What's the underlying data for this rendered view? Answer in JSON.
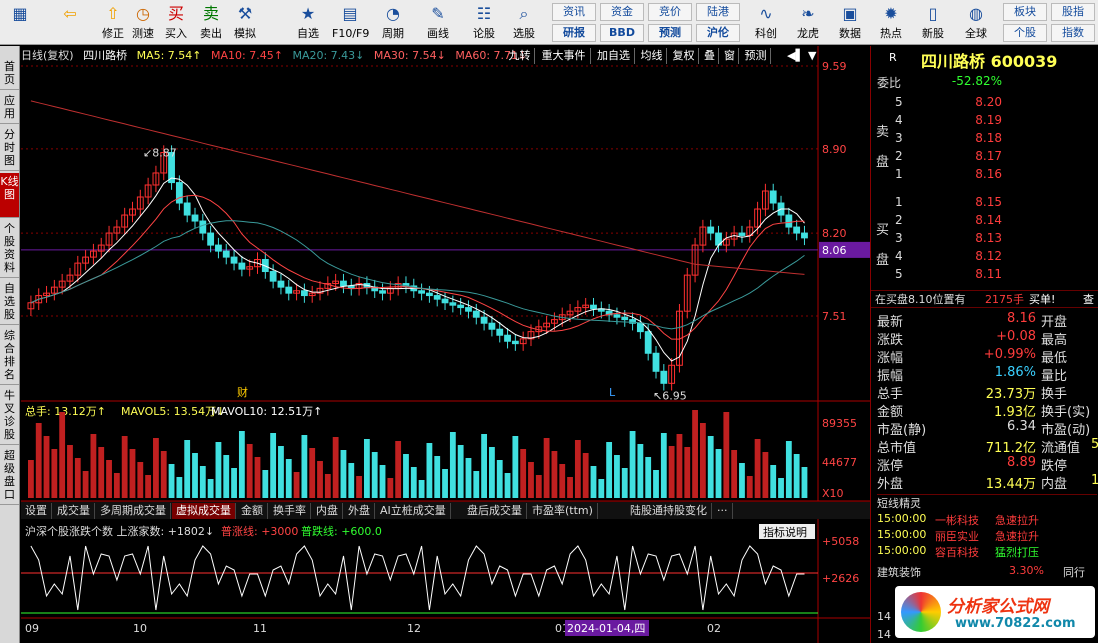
{
  "toolbar": {
    "big": [
      {
        "label": "",
        "icon": "windows-icon"
      },
      {
        "label": "",
        "icon": "back-arrow-icon"
      },
      {
        "label": "修正",
        "icon": "up-arrow-icon"
      },
      {
        "label": "测速",
        "icon": "clock-icon"
      },
      {
        "label": "买入",
        "icon": "buy-icon",
        "glyph": "买"
      },
      {
        "label": "卖出",
        "icon": "sell-icon",
        "glyph": "卖"
      },
      {
        "label": "模拟",
        "icon": "hammer-icon"
      },
      {
        "label": "自选",
        "icon": "star-icon"
      },
      {
        "label": "F10/F9",
        "icon": "f10-icon"
      },
      {
        "label": "周期",
        "icon": "cycle-icon"
      },
      {
        "label": "画线",
        "icon": "pen-icon"
      },
      {
        "label": "论股",
        "icon": "discuss-icon"
      },
      {
        "label": "选股",
        "icon": "search-icon"
      },
      {
        "label": "科创",
        "icon": "kechuang-icon"
      },
      {
        "label": "龙虎",
        "icon": "dragon-icon"
      },
      {
        "label": "数据",
        "icon": "pe-icon"
      },
      {
        "label": "热点",
        "icon": "hot-icon"
      },
      {
        "label": "新股",
        "icon": "ipo-icon"
      },
      {
        "label": "全球",
        "icon": "globe-icon"
      }
    ],
    "small": [
      [
        "资讯",
        "研报"
      ],
      [
        "资金",
        "BBD"
      ],
      [
        "竞价",
        "预测"
      ],
      [
        "陆港",
        "沪伦"
      ]
    ],
    "right": [
      [
        "板块",
        "个股"
      ],
      [
        "股指",
        "指数"
      ]
    ]
  },
  "sidebar": [
    "首页",
    "应用",
    "分时图",
    "K线图",
    "个股资料",
    "自选股",
    "综合排名",
    "牛叉诊股",
    "超级盘口"
  ],
  "header": {
    "period": "日线(复权)",
    "name": "四川路桥",
    "ma5": "MA5: 7.54↑",
    "ma10": "MA10: 7.45↑",
    "ma20": "MA20: 7.43↓",
    "ma30": "MA30: 7.54↓",
    "ma60": "MA60: 7.71↓",
    "buttons": [
      "九转",
      "重大事件",
      "加自选",
      "均线",
      "复权",
      "叠",
      "窗",
      "预测"
    ]
  },
  "price_axis": [
    "9.59",
    "8.90",
    "8.20",
    "8.06",
    "7.51"
  ],
  "annotations": {
    "high": "8.87",
    "low": "6.95",
    "fin": "财",
    "l": "L"
  },
  "volume": {
    "label": "总手: 13.12万↑",
    "mavol5": "MAVOL5: 13.54万↓",
    "mavol10": "MAVOL10: 12.51万↑",
    "axis": [
      "89355",
      "44677",
      "X10"
    ]
  },
  "tabs": [
    "设置",
    "成交量",
    "多周期成交量",
    "虚拟成交量",
    "金额",
    "换手率",
    "内盘",
    "外盘",
    "AI立桩成交量",
    "盘后成交量",
    "市盈率(ttm)",
    "陆股通持股变化",
    "···"
  ],
  "indicator": {
    "label": "沪深个股涨跌个数 上涨家数: +1802↓",
    "l2": "普涨线: +3000",
    "l3": "普跌线: +600.0",
    "help": "指标说明",
    "axis": [
      "+5058",
      "+2626"
    ]
  },
  "xaxis": [
    "09",
    "10",
    "11",
    "12",
    "01",
    "2024-01-04,四",
    "02"
  ],
  "right": {
    "title": "四川路桥 600039",
    "r": "R",
    "weibi_label": "委比",
    "weibi": "-52.82%",
    "sell_label": "卖盘",
    "sell": [
      [
        "5",
        "8.20"
      ],
      [
        "4",
        "8.19"
      ],
      [
        "3",
        "8.18"
      ],
      [
        "2",
        "8.17"
      ],
      [
        "1",
        "8.16"
      ]
    ],
    "buy_label": "买盘",
    "buy": [
      [
        "1",
        "8.15"
      ],
      [
        "2",
        "8.14"
      ],
      [
        "3",
        "8.13"
      ],
      [
        "4",
        "8.12"
      ],
      [
        "5",
        "8.11"
      ]
    ],
    "notice": "在买盘8.10位置有",
    "notice_vol": "2175手",
    "notice_tag": "买单!",
    "notice_q": "查",
    "stats": [
      [
        "最新",
        "8.16",
        "开盘"
      ],
      [
        "涨跌",
        "+0.08",
        "最高"
      ],
      [
        "涨幅",
        "+0.99%",
        "最低"
      ],
      [
        "振幅",
        "1.86%",
        "量比"
      ],
      [
        "总手",
        "23.73万",
        "换手"
      ],
      [
        "金额",
        "1.93亿",
        "换手(实)"
      ],
      [
        "市盈(静)",
        "6.34",
        "市盈(动)"
      ],
      [
        "总市值",
        "711.2亿",
        "流通值"
      ],
      [
        "涨停",
        "8.89",
        "跌停"
      ],
      [
        "外盘",
        "13.44万",
        "内盘"
      ]
    ],
    "extra": [
      "5",
      "1"
    ],
    "short_title": "短线精灵",
    "short": [
      [
        "15:00:00",
        "一彬科技",
        "急速拉升"
      ],
      [
        "15:00:00",
        "丽臣实业",
        "急速拉升"
      ],
      [
        "15:00:00",
        "容百科技",
        "猛烈打压"
      ]
    ],
    "sector": "建筑装饰",
    "sector_pct": "3.30%",
    "sector_more": "同行",
    "bottom": [
      "14",
      "14"
    ],
    "logo": "分析家公式网",
    "logo_url": "www.70822.com"
  }
}
